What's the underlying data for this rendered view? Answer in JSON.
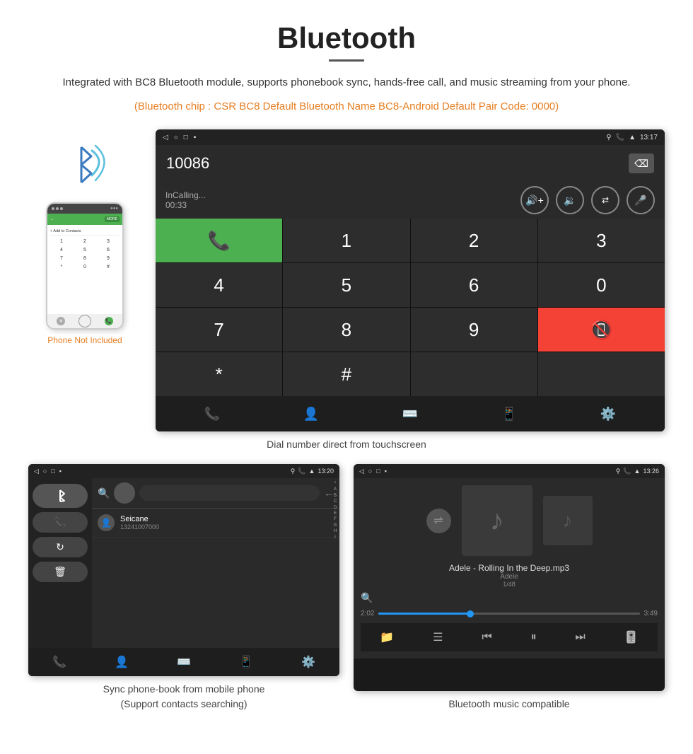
{
  "header": {
    "title": "Bluetooth",
    "description": "Integrated with BC8 Bluetooth module, supports phonebook sync, hands-free call, and music streaming from your phone.",
    "orange_info": "(Bluetooth chip : CSR BC8    Default Bluetooth Name BC8-Android    Default Pair Code: 0000)"
  },
  "dialer_screen": {
    "status_time": "13:17",
    "status_icons_left": [
      "◁",
      "○",
      "□"
    ],
    "dialed_number": "10086",
    "incalling_label": "InCalling...",
    "incalling_time": "00:33",
    "keys": [
      "1",
      "2",
      "3",
      "4",
      "5",
      "6",
      "7",
      "8",
      "9",
      "*",
      "0",
      "#"
    ],
    "call_green_icon": "📞",
    "call_red_icon": "📞"
  },
  "phonebook_screen": {
    "status_time": "13:20",
    "contact_name": "Seicane",
    "contact_phone": "13241007000",
    "alpha_letters": [
      "*",
      "A",
      "B",
      "C",
      "D",
      "E",
      "F",
      "G",
      "H",
      "I"
    ]
  },
  "music_screen": {
    "status_time": "13:26",
    "track_name": "Adele - Rolling In the Deep.mp3",
    "artist": "Adele",
    "track_count": "1/48",
    "time_current": "2:02",
    "time_total": "3:49"
  },
  "captions": {
    "dial_caption": "Dial number direct from touchscreen",
    "phonebook_caption": "Sync phone-book from mobile phone\n(Support contacts searching)",
    "music_caption": "Bluetooth music compatible"
  },
  "phone_side": {
    "not_included": "Phone Not Included",
    "keypad_keys": [
      "1",
      "2",
      "3",
      "4",
      "5",
      "6",
      "7",
      "8",
      "9",
      "*",
      "0",
      "#"
    ]
  }
}
